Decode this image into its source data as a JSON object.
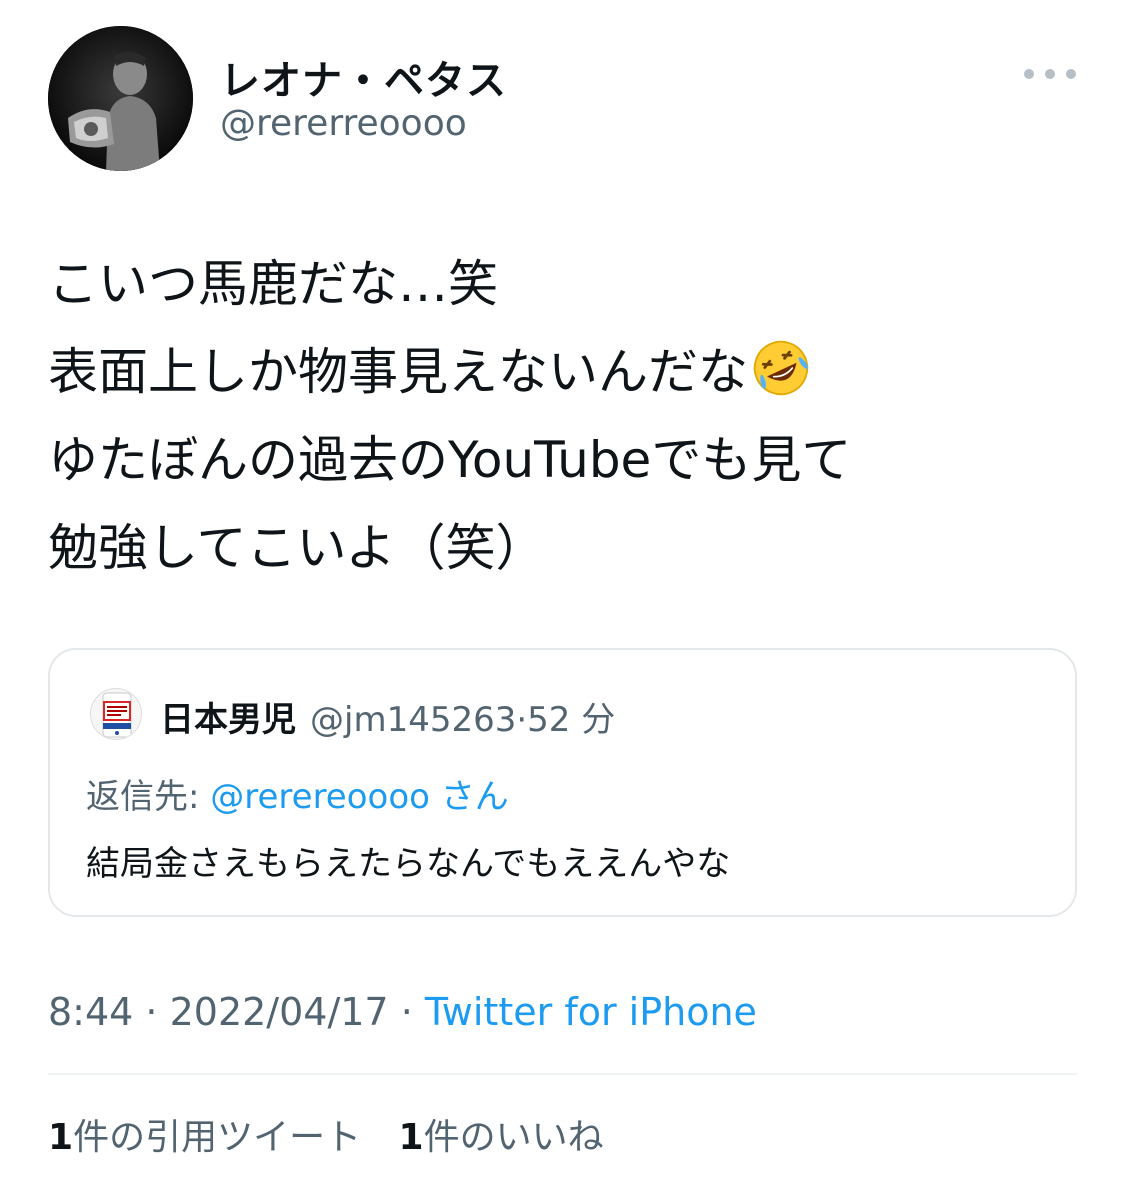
{
  "author": {
    "display_name": "レオナ・ペタス",
    "handle": "@rererreoooo",
    "avatar_icon": "profile-photo-icon"
  },
  "more_icon": "more-horizontal-icon",
  "tweet": {
    "lines": [
      "こいつ馬鹿だな…笑",
      "表面上しか物事見えないんだな",
      "ゆたぼんの過去のYouTubeでも見て",
      "勉強してこいよ（笑）"
    ],
    "emoji": "rolling-on-floor-laughing-emoji"
  },
  "quote": {
    "avatar_icon": "beer-can-avatar-icon",
    "name": "日本男児",
    "handle": "@jm145263",
    "dot": "·",
    "time": "52 分",
    "reply_prefix": "返信先:",
    "reply_mention": "@rerereoooo",
    "reply_suffix": "さん",
    "text": "結局金さえもらえたらなんでもええんやな"
  },
  "meta": {
    "time": "8:44",
    "sep1": " · ",
    "date": "2022/04/17",
    "sep2": " · ",
    "source": "Twitter for iPhone"
  },
  "stats": {
    "quote_count": "1",
    "quote_label": "件の引用ツイート",
    "like_count": "1",
    "like_label": "件のいいね"
  },
  "colors": {
    "accent": "#1d9bf0",
    "secondary_text": "#536471",
    "primary_text": "#0f1419",
    "border": "#e4e8eb"
  }
}
